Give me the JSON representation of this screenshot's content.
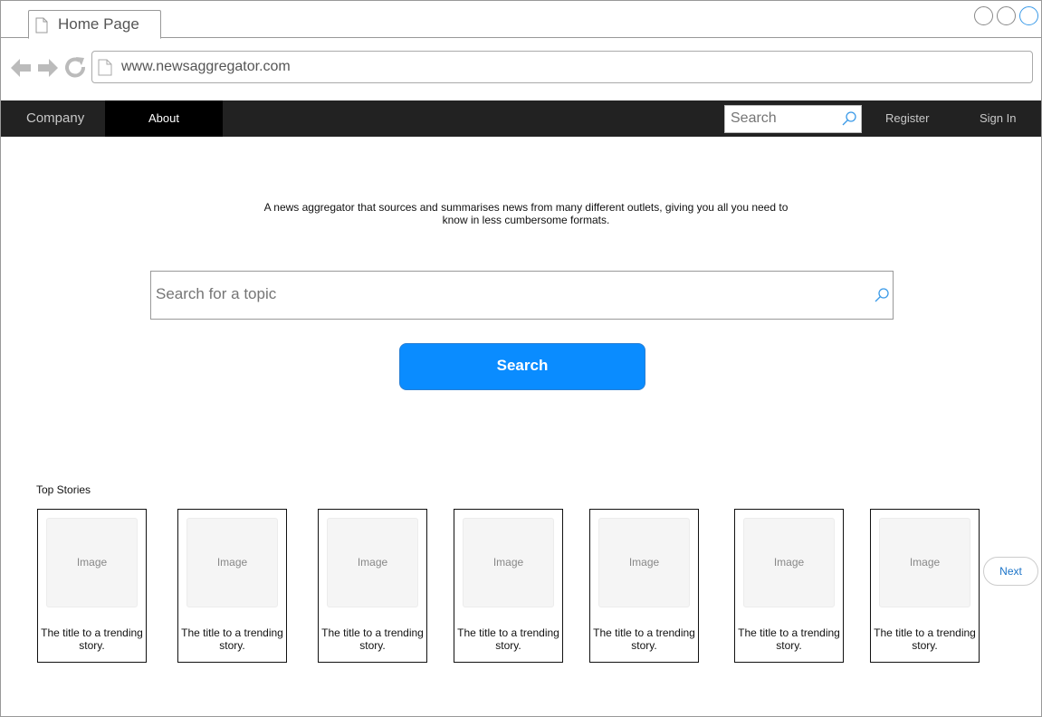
{
  "browser": {
    "tab_title": "Home Page",
    "url": "www.newsaggregator.com",
    "icons": [
      "back-arrow-icon",
      "forward-arrow-icon",
      "reload-icon",
      "document-icon"
    ],
    "window_controls": [
      "minimize",
      "maximize",
      "close"
    ]
  },
  "nav": {
    "company": "Company",
    "about": "About",
    "search_placeholder": "Search",
    "register": "Register",
    "sign_in": "Sign In"
  },
  "main": {
    "tagline": "A news aggregator that sources and summarises news from many different outlets, giving you all you need to know in less cumbersome formats.",
    "topic_placeholder": "Search for a topic",
    "search_button": "Search"
  },
  "stories": {
    "heading": "Top Stories",
    "items": [
      {
        "image_label": "Image",
        "title": "The title to a trending story."
      },
      {
        "image_label": "Image",
        "title": "The title to a trending story."
      },
      {
        "image_label": "Image",
        "title": "The title to a trending story."
      },
      {
        "image_label": "Image",
        "title": "The title to a trending story."
      },
      {
        "image_label": "Image",
        "title": "The title to a trending story."
      },
      {
        "image_label": "Image",
        "title": "The title to a trending story."
      },
      {
        "image_label": "Image",
        "title": "The title to a trending story."
      }
    ],
    "next": "Next"
  },
  "colors": {
    "nav_bg": "#222222",
    "nav_active_bg": "#000000",
    "accent": "#0a8cff",
    "link": "#1a73c8"
  }
}
